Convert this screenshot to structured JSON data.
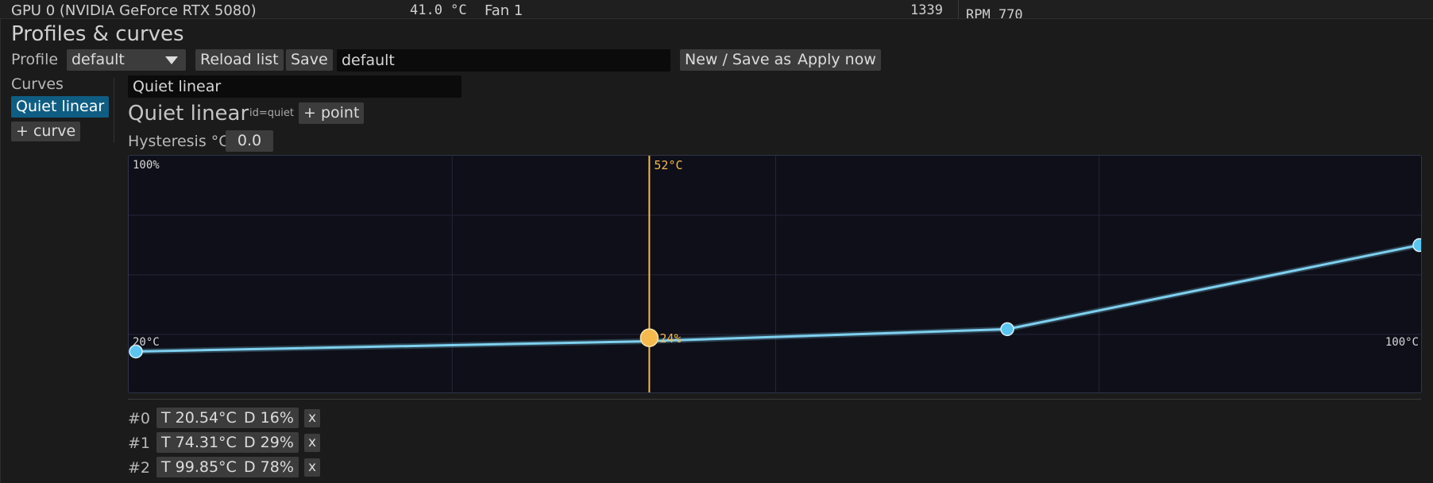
{
  "topbar": {
    "device": "GPU 0 (NVIDIA GeForce RTX 5080)",
    "temp": "41.0 °C",
    "fan": "Fan 1",
    "value": "1339",
    "rpm": "RPM 770"
  },
  "panel": {
    "title": "Profiles & curves",
    "profile_label": "Profile",
    "profile_select": "default",
    "reload_label": "Reload list",
    "save_label": "Save",
    "profile_name_value": "default",
    "save_as_label": "New / Save as",
    "apply_label": "Apply now"
  },
  "curves": {
    "label": "Curves",
    "items": [
      {
        "label": "Quiet linear",
        "active": true
      }
    ],
    "add_label": "+ curve"
  },
  "editor": {
    "name_value": "Quiet linear",
    "heading": "Quiet linear",
    "id_text": "id=quiet",
    "add_point_label": "+ point",
    "hysteresis_label": "Hysteresis °C",
    "hysteresis_value": "0.0"
  },
  "chart_data": {
    "type": "line",
    "x_min_label": "20°C",
    "x_max_label": "100°C",
    "y_max_label": "100%",
    "xlim": [
      20,
      100
    ],
    "ylim": [
      0,
      100
    ],
    "grid": true,
    "series": [
      {
        "x": [
          20,
          51.5,
          74.31,
          100
        ],
        "y": [
          16,
          21.9,
          29,
          78
        ]
      }
    ],
    "cursor": {
      "x": 52,
      "y": 24,
      "x_label": "52°C",
      "y_label": "24%"
    },
    "colors": {
      "line": "#7fd0ef",
      "point": "#5bc4ef",
      "cursor": "#f5b94e",
      "grid": "#23263a"
    }
  },
  "points": [
    {
      "index": "#0",
      "temp": "T 20.54°C",
      "duty": "D 16%",
      "remove": "x"
    },
    {
      "index": "#1",
      "temp": "T 74.31°C",
      "duty": "D 29%",
      "remove": "x"
    },
    {
      "index": "#2",
      "temp": "T 99.85°C",
      "duty": "D 78%",
      "remove": "x"
    }
  ]
}
